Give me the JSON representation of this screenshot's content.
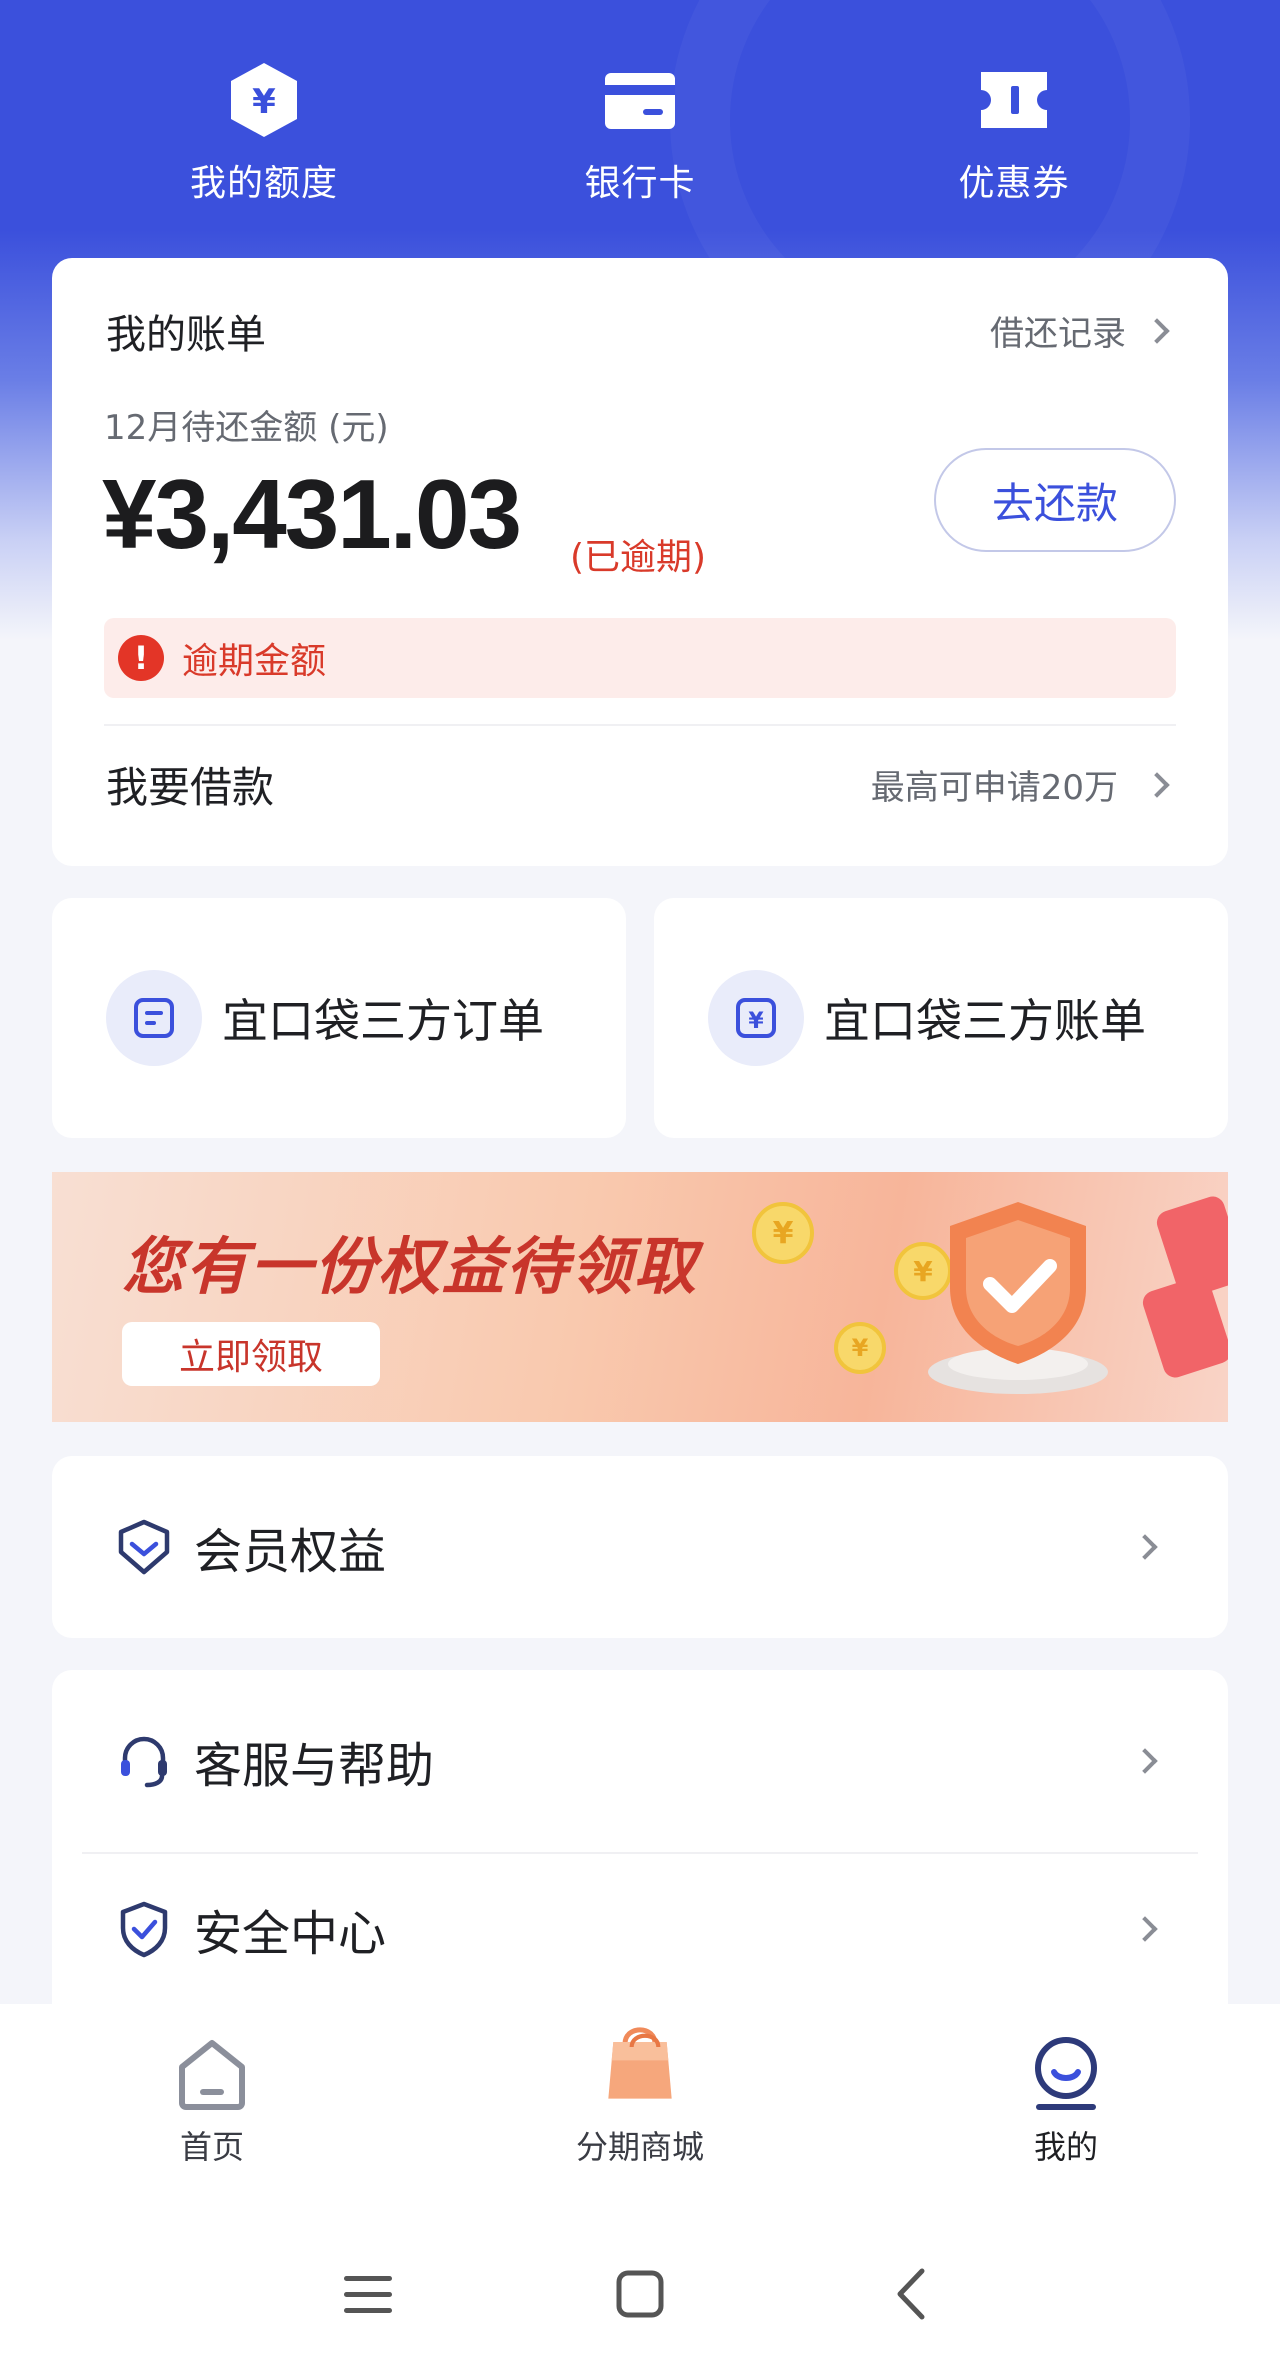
{
  "colors": {
    "primary": "#3b50dc",
    "danger": "#d93a2a",
    "background": "#f4f5fa"
  },
  "quick_actions": [
    {
      "label": "我的额度",
      "icon": "yuan-hexagon-icon"
    },
    {
      "label": "银行卡",
      "icon": "bank-card-icon"
    },
    {
      "label": "优惠券",
      "icon": "coupon-ticket-icon"
    }
  ],
  "bill": {
    "title": "我的账单",
    "records_link": "借还记录",
    "subtitle": "12月待还金额 (元)",
    "amount": "¥3,431.03",
    "overdue_tag": "(已逾期)",
    "repay_button": "去还款",
    "overdue_label": "逾期金额"
  },
  "borrow": {
    "title": "我要借款",
    "hint": "最高可申请20万"
  },
  "shortcuts": [
    {
      "label": "宜口袋三方订单",
      "icon": "order-doc-icon"
    },
    {
      "label": "宜口袋三方账单",
      "icon": "bill-yuan-icon"
    }
  ],
  "banner": {
    "headline": "您有一份权益待领取",
    "button": "立即领取"
  },
  "menu_sections": [
    [
      {
        "label": "会员权益",
        "icon": "membership-gem-icon"
      }
    ],
    [
      {
        "label": "客服与帮助",
        "icon": "headset-icon"
      },
      {
        "label": "安全中心",
        "icon": "shield-check-icon"
      }
    ]
  ],
  "tabs": [
    {
      "label": "首页",
      "icon": "home-icon",
      "active": false
    },
    {
      "label": "分期商城",
      "icon": "shopping-bag-icon",
      "active": false
    },
    {
      "label": "我的",
      "icon": "profile-icon",
      "active": true
    }
  ]
}
